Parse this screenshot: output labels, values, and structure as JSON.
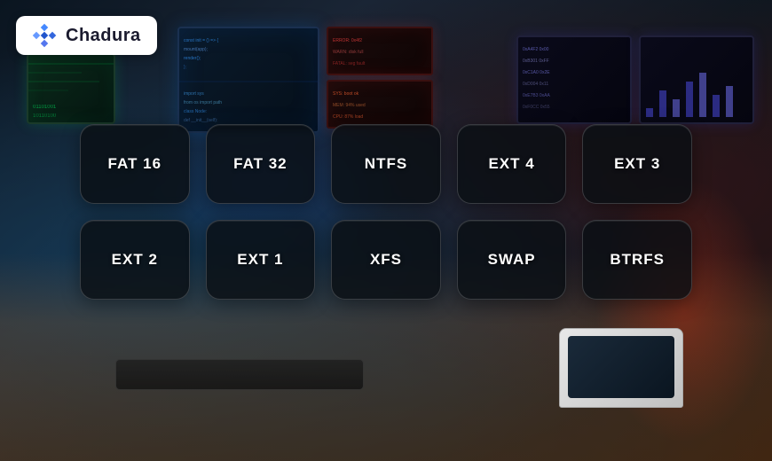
{
  "app": {
    "title": "Chadura",
    "logo_alt": "Chadura logo"
  },
  "filesystem_buttons": [
    {
      "id": "fat16",
      "label": "FAT 16",
      "row": 1,
      "col": 1
    },
    {
      "id": "fat32",
      "label": "FAT 32",
      "row": 1,
      "col": 2
    },
    {
      "id": "ntfs",
      "label": "NTFS",
      "row": 1,
      "col": 3
    },
    {
      "id": "ext4",
      "label": "EXT 4",
      "row": 1,
      "col": 4
    },
    {
      "id": "ext3",
      "label": "EXT 3",
      "row": 1,
      "col": 5
    },
    {
      "id": "ext2",
      "label": "EXT 2",
      "row": 2,
      "col": 1
    },
    {
      "id": "ext1",
      "label": "EXT 1",
      "row": 2,
      "col": 2
    },
    {
      "id": "xfs",
      "label": "XFS",
      "row": 2,
      "col": 3
    },
    {
      "id": "swap",
      "label": "SWAP",
      "row": 2,
      "col": 4
    },
    {
      "id": "btrfs",
      "label": "BTRFS",
      "row": 2,
      "col": 5
    }
  ],
  "colors": {
    "bg_dark": "#0a1520",
    "button_bg": "rgba(10,15,20,0.82)",
    "border": "rgba(255,255,255,0.18)",
    "text": "#ffffff",
    "logo_bg": "#ffffff"
  }
}
